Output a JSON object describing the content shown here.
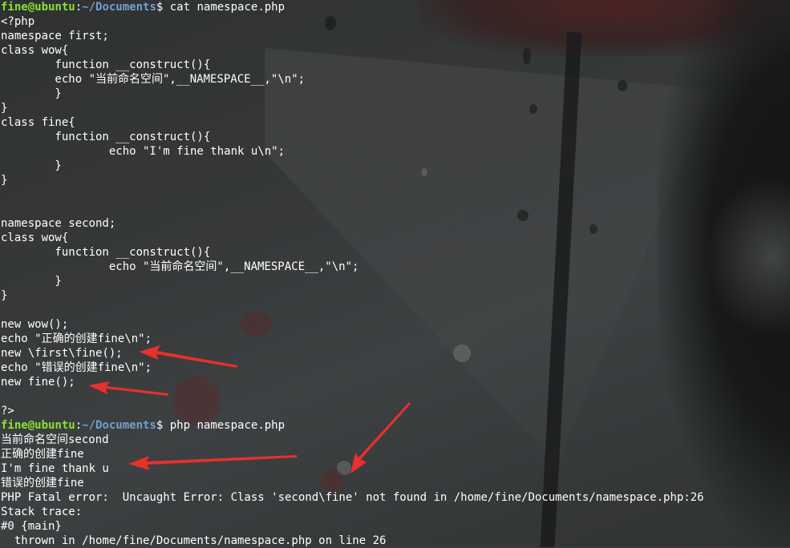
{
  "background": {
    "description_colors": {
      "accent_red": "#e8302c",
      "prompt_user": "#8ae234",
      "prompt_path": "#729fcf",
      "text": "#ffffff"
    }
  },
  "prompt1": {
    "user_host": "fine@ubuntu",
    "colon": ":",
    "path": "~/Documents",
    "dollar": "$",
    "command": " cat namespace.php"
  },
  "code_lines": [
    "<?php",
    "namespace first;",
    "class wow{",
    "        function __construct(){",
    "        echo \"当前命名空间\",__NAMESPACE__,\"\\n\";",
    "        }",
    "}",
    "class fine{",
    "        function __construct(){",
    "                echo \"I'm fine thank u\\n\";",
    "        }",
    "}",
    "",
    "",
    "namespace second;",
    "class wow{",
    "        function __construct(){",
    "                echo \"当前命名空间\",__NAMESPACE__,\"\\n\";",
    "        }",
    "}",
    "",
    "new wow();",
    "echo \"正确的创建fine\\n\";",
    "new \\first\\fine();",
    "echo \"错误的创建fine\\n\";",
    "new fine();",
    "",
    "?>"
  ],
  "prompt2": {
    "user_host": "fine@ubuntu",
    "colon": ":",
    "path": "~/Documents",
    "dollar": "$",
    "command": " php namespace.php"
  },
  "output_lines": [
    "当前命名空间second",
    "正确的创建fine",
    "I'm fine thank u",
    "错误的创建fine",
    "PHP Fatal error:  Uncaught Error: Class 'second\\fine' not found in /home/fine/Documents/namespace.php:26",
    "Stack trace:",
    "#0 {main}",
    "  thrown in /home/fine/Documents/namespace.php on line 26"
  ]
}
